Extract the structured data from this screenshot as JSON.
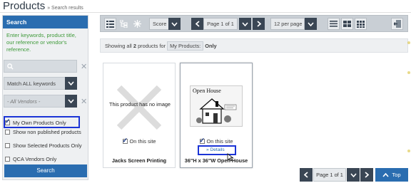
{
  "header": {
    "title": "Products",
    "breadcrumb": "» Search results"
  },
  "sidebar": {
    "title": "Search",
    "hint": "Enter keywords, product title, our reference or vendor's reference.",
    "search": {
      "value": "",
      "icon": "search-icon"
    },
    "match_select": "Match ALL keywords",
    "vendor_select": "- All Vendors -",
    "checkboxes": [
      {
        "label": "My Own Products Only",
        "checked": true
      },
      {
        "label": "Show non published products",
        "checked": false
      },
      {
        "label": "Show Selected Products Only",
        "checked": false
      },
      {
        "label": "QCA Vendors Only",
        "checked": false
      }
    ],
    "search_button": "Search"
  },
  "toolbar": {
    "sort_value": "Score",
    "page_label": "Page 1 of 1",
    "per_page": "12 per page"
  },
  "summary": {
    "prefix": "Showing all",
    "count": "2",
    "middle": "products for",
    "filter_label": "My Products:",
    "filter_value": "Only"
  },
  "products": [
    {
      "name": "Jacks Screen Printing",
      "no_image_text": "This product has no image",
      "on_site_label": "On this site",
      "on_site": true
    },
    {
      "name": "36\"H x 36\"W Open House",
      "thumb_text": "Open House",
      "on_site_label": "On this site",
      "on_site": true,
      "details_link": "» Details"
    }
  ],
  "pager": {
    "label": "Page 1 of 1",
    "top_button": "Top"
  },
  "colors": {
    "accent": "#2a6db0",
    "dark_button": "#3a4654",
    "hint_green": "#3f9a3a",
    "highlight": "#1b34d6"
  }
}
